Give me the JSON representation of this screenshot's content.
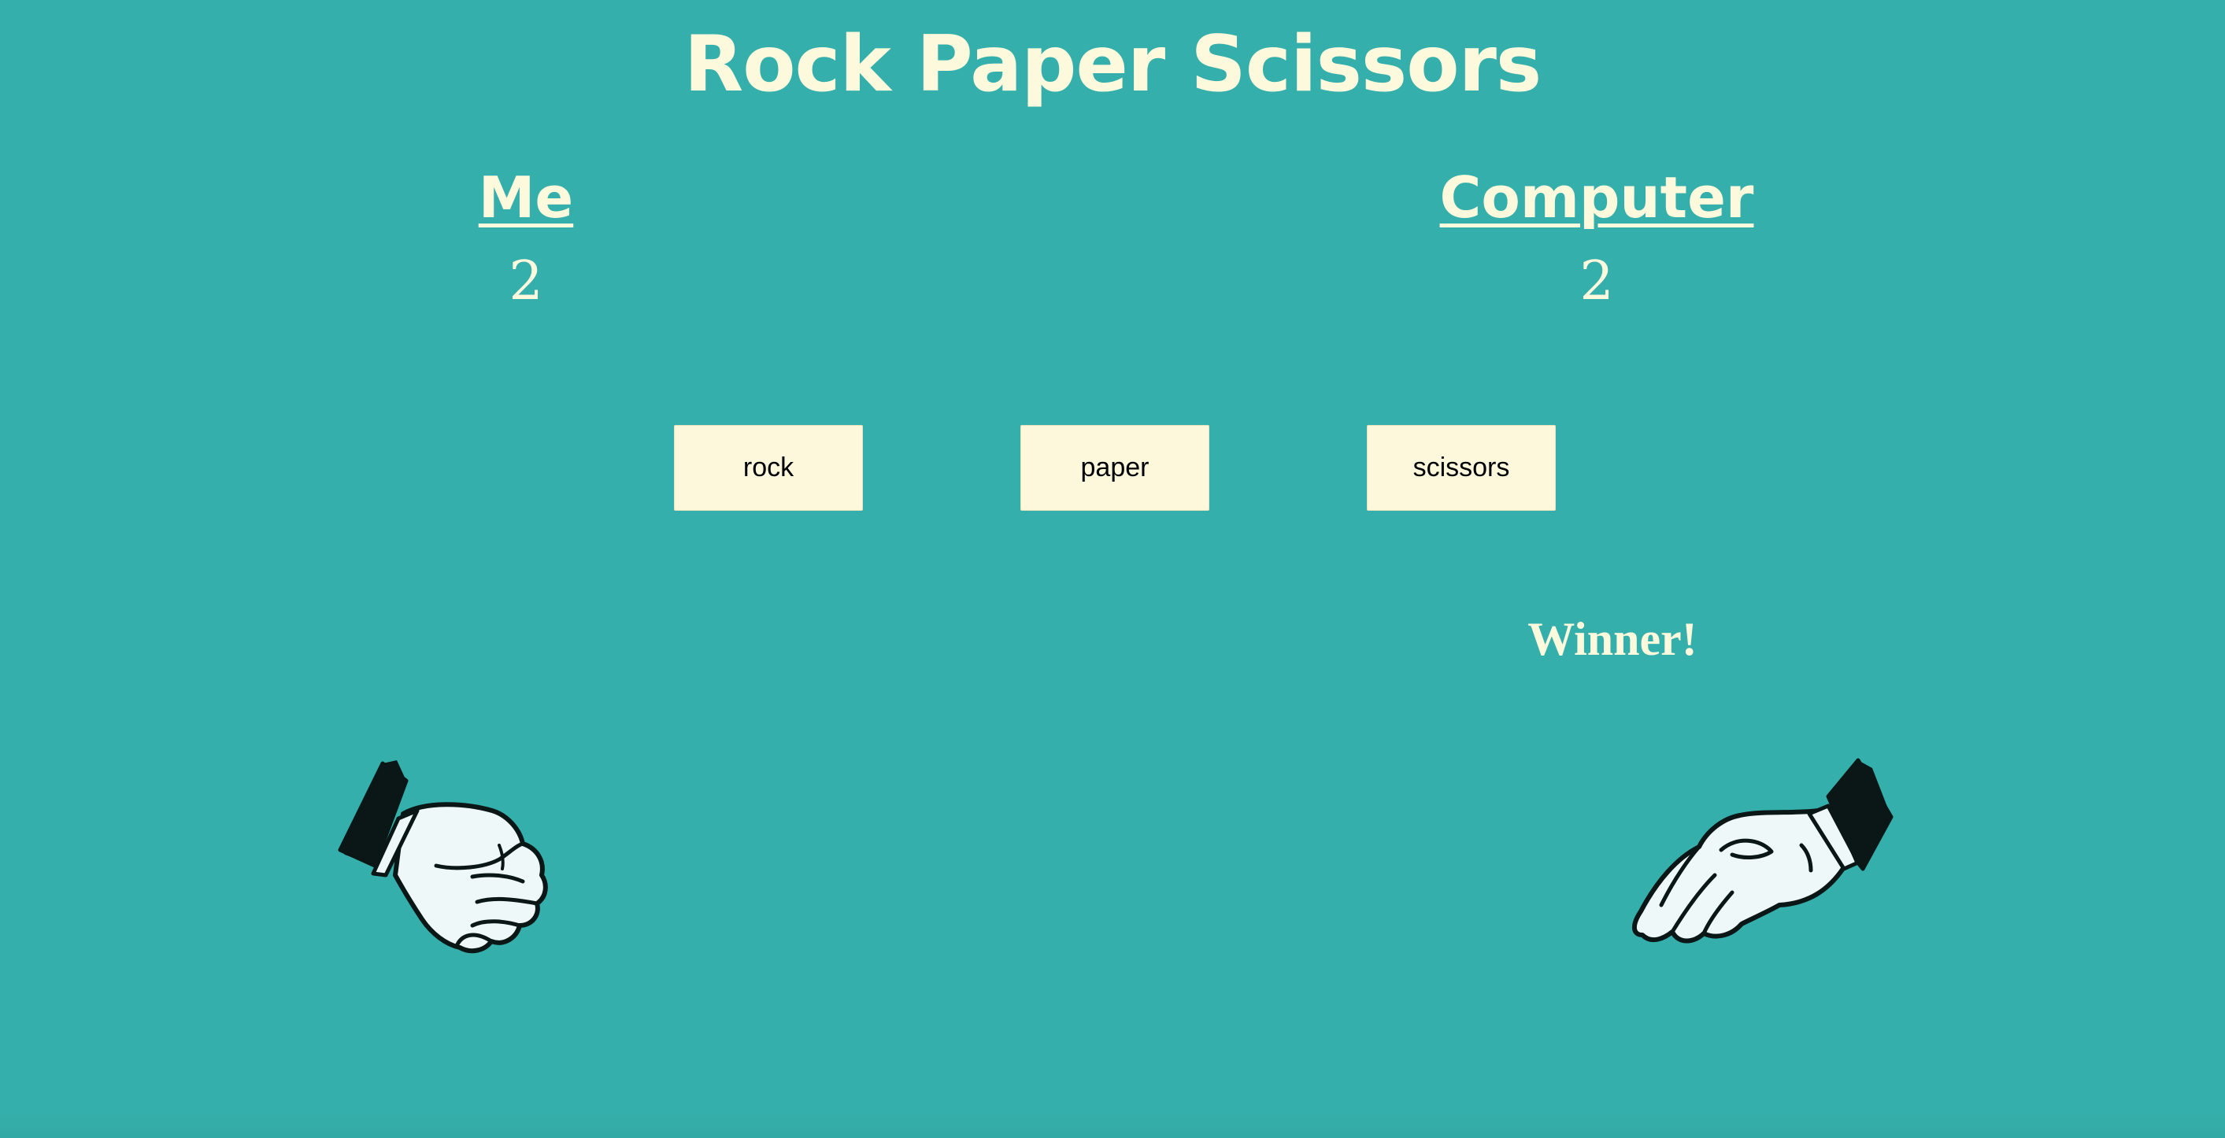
{
  "header": {
    "title": "Rock Paper Scissors"
  },
  "players": {
    "me": {
      "name": "Me",
      "score": "2",
      "hand_icon": "rock-fist-icon"
    },
    "computer": {
      "name": "Computer",
      "score": "2",
      "hand_icon": "paper-open-hand-icon"
    }
  },
  "choices": {
    "rock_label": "rock",
    "paper_label": "paper",
    "scissors_label": "scissors"
  },
  "result": {
    "text": "Winner!"
  },
  "colors": {
    "background": "#35afab",
    "text": "#fdf9dc",
    "button": "#fdf8dc",
    "glove": "#eef8f8",
    "cuff": "#0a1716"
  }
}
